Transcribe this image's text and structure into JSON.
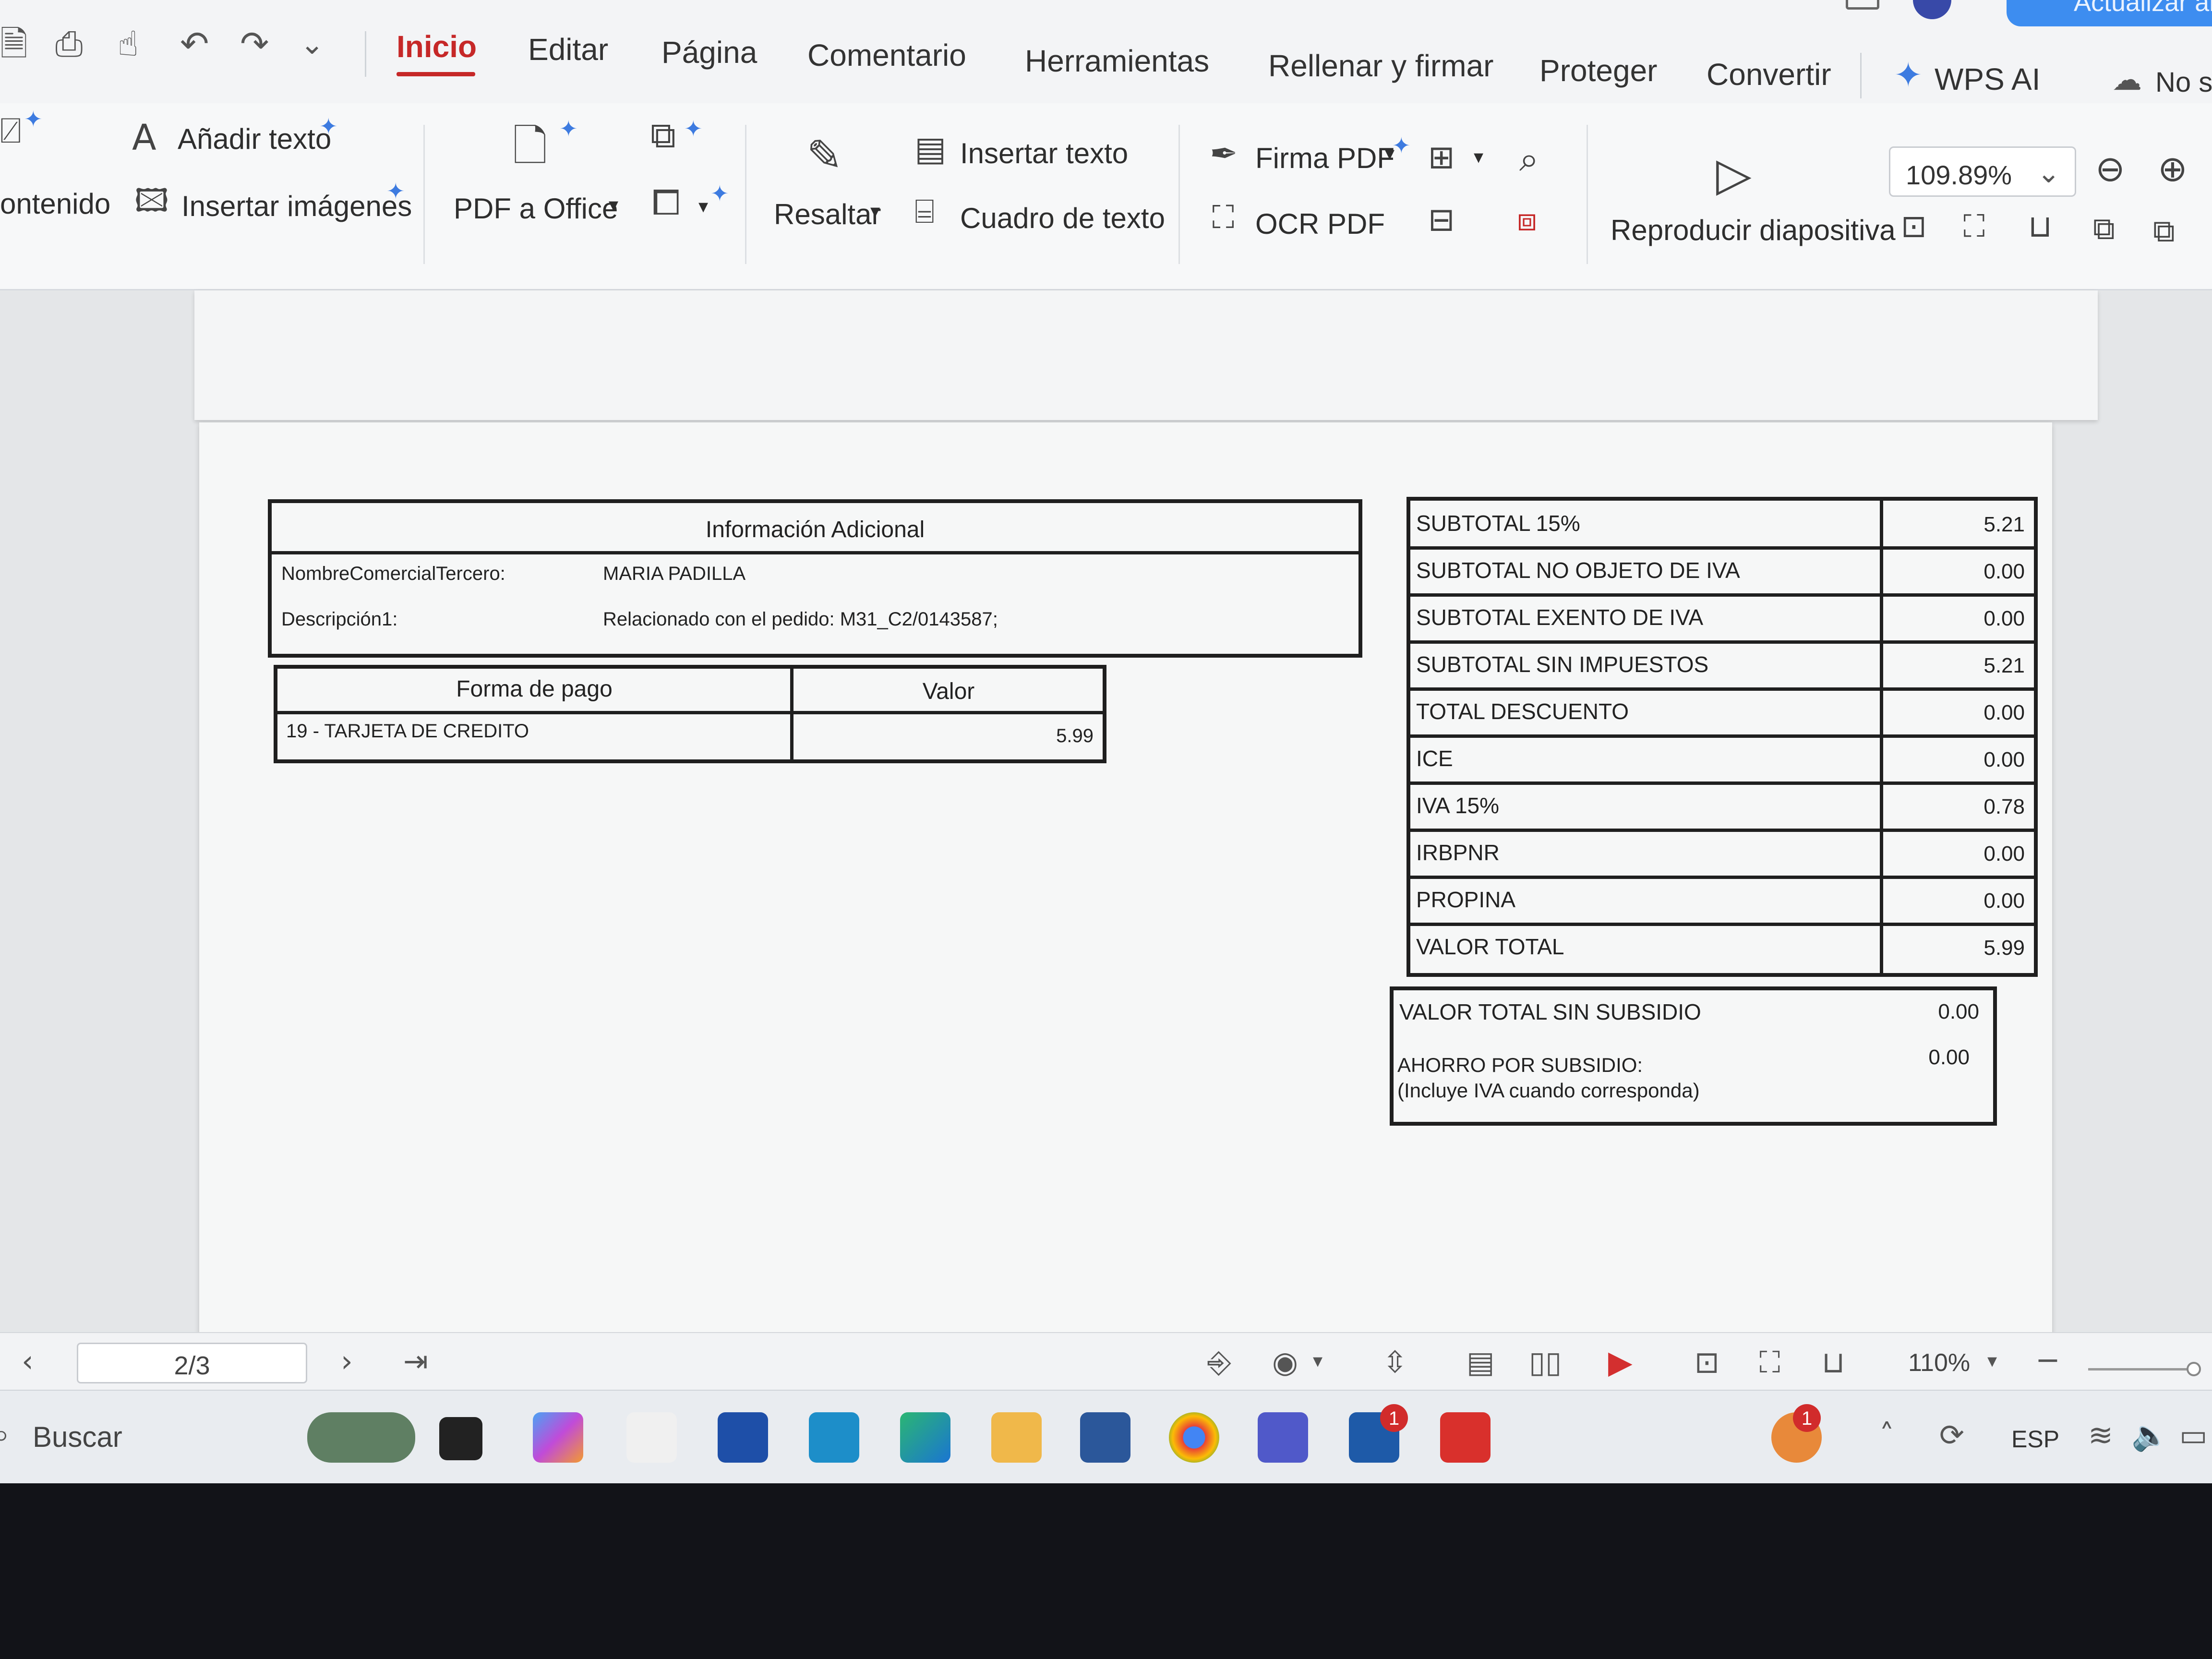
{
  "menu": {
    "tabs": [
      "Inicio",
      "Editar",
      "Página",
      "Comentario",
      "Herramientas",
      "Rellenar y firmar",
      "Proteger",
      "Convertir"
    ],
    "wps_ai": "WPS AI",
    "sign_in": "No si",
    "update": "Actualizar ar"
  },
  "ribbon": {
    "contenido": "ontenido",
    "add_text": "Añadir texto",
    "insert_images": "Insertar imágenes",
    "pdf_to_office": "PDF a Office",
    "highlight": "Resaltar",
    "insert_text": "Insertar texto",
    "text_box": "Cuadro de texto",
    "sign_pdf": "Firma PDF",
    "ocr_pdf": "OCR PDF",
    "play_slideshow": "Reproducir diapositiva",
    "zoom": "109.89%"
  },
  "document": {
    "info": {
      "title": "Información Adicional",
      "rows": [
        {
          "label": "NombreComercialTercero:",
          "value": "MARIA PADILLA"
        },
        {
          "label": "Descripción1:",
          "value": "Relacionado con el pedido: M31_C2/0143587;"
        }
      ]
    },
    "payment": {
      "col_method": "Forma de pago",
      "col_value": "Valor",
      "method": "19 - TARJETA DE CREDITO",
      "value": "5.99"
    },
    "totals": [
      {
        "label": "SUBTOTAL 15%",
        "value": "5.21"
      },
      {
        "label": "SUBTOTAL NO OBJETO DE IVA",
        "value": "0.00"
      },
      {
        "label": "SUBTOTAL EXENTO DE IVA",
        "value": "0.00"
      },
      {
        "label": "SUBTOTAL SIN IMPUESTOS",
        "value": "5.21"
      },
      {
        "label": "TOTAL DESCUENTO",
        "value": "0.00"
      },
      {
        "label": "ICE",
        "value": "0.00"
      },
      {
        "label": "IVA 15%",
        "value": "0.78"
      },
      {
        "label": "IRBPNR",
        "value": "0.00"
      },
      {
        "label": "PROPINA",
        "value": "0.00"
      },
      {
        "label": "VALOR TOTAL",
        "value": "5.99"
      }
    ],
    "subsidy": {
      "total_label": "VALOR TOTAL SIN SUBSIDIO",
      "total_value": "0.00",
      "saving_label": "AHORRO POR SUBSIDIO:",
      "saving_note": "(Incluye IVA cuando corresponda)",
      "saving_value": "0.00"
    }
  },
  "status": {
    "page": "2/3",
    "zoom": "110%"
  },
  "taskbar": {
    "search": "Buscar",
    "language": "ESP",
    "badge_l": "1",
    "badge_people": "1"
  },
  "colors": {
    "accent": "#c62828",
    "wps_ai": "#3d7be0",
    "update_button": "#3d8df0"
  }
}
